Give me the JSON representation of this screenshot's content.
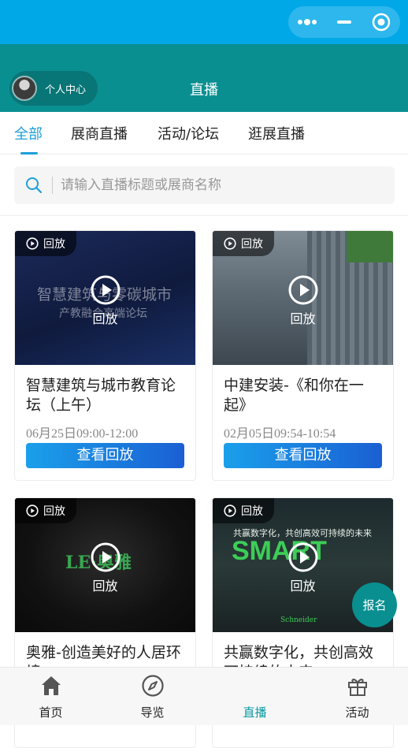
{
  "window": {
    "capsule_icons": [
      "more-dots-icon",
      "minimize-icon",
      "target-close-icon"
    ]
  },
  "header": {
    "profile_label": "个人中心",
    "title": "直播"
  },
  "tabs": [
    {
      "label": "全部",
      "active": true
    },
    {
      "label": "展商直播",
      "active": false
    },
    {
      "label": "活动/论坛",
      "active": false
    },
    {
      "label": "逛展直播",
      "active": false
    }
  ],
  "search": {
    "placeholder": "请输入直播标题或展商名称"
  },
  "cards": [
    {
      "badge": "回放",
      "overlay": "回放",
      "title": "智慧建筑与城市教育论坛（上午）",
      "time": "06月25日09:00-12:00",
      "button": "查看回放",
      "thumb_text": "智慧建筑与零碳城市",
      "thumb_subtext": "产教融合高端论坛"
    },
    {
      "badge": "回放",
      "overlay": "回放",
      "title": "中建安装-《和你在一起》",
      "time": "02月05日09:54-10:54",
      "button": "查看回放"
    },
    {
      "badge": "回放",
      "overlay": "回放",
      "title": "奥雅-创造美好的人居环境",
      "time": "",
      "button": "",
      "thumb_text": "LE·奥雅"
    },
    {
      "badge": "回放",
      "overlay": "回放",
      "title": "共赢数字化，共创高效可持续的未来",
      "time": "",
      "button": "",
      "thumb_text": "共赢数字化，共创高效可持续的未来",
      "thumb_subtext": "SMART",
      "thumb_brand": "Schneider"
    }
  ],
  "fab": {
    "label": "报名"
  },
  "tabbar": [
    {
      "label": "首页",
      "icon": "home-icon",
      "active": false
    },
    {
      "label": "导览",
      "icon": "compass-icon",
      "active": false
    },
    {
      "label": "直播",
      "icon": "",
      "active": true
    },
    {
      "label": "活动",
      "icon": "gift-icon",
      "active": false
    }
  ],
  "colors": {
    "statusbar": "#00a8e8",
    "header": "#0a8f91",
    "accent": "#1e9fd8",
    "button_start": "#1aa0ea",
    "button_end": "#1a5fd3"
  }
}
